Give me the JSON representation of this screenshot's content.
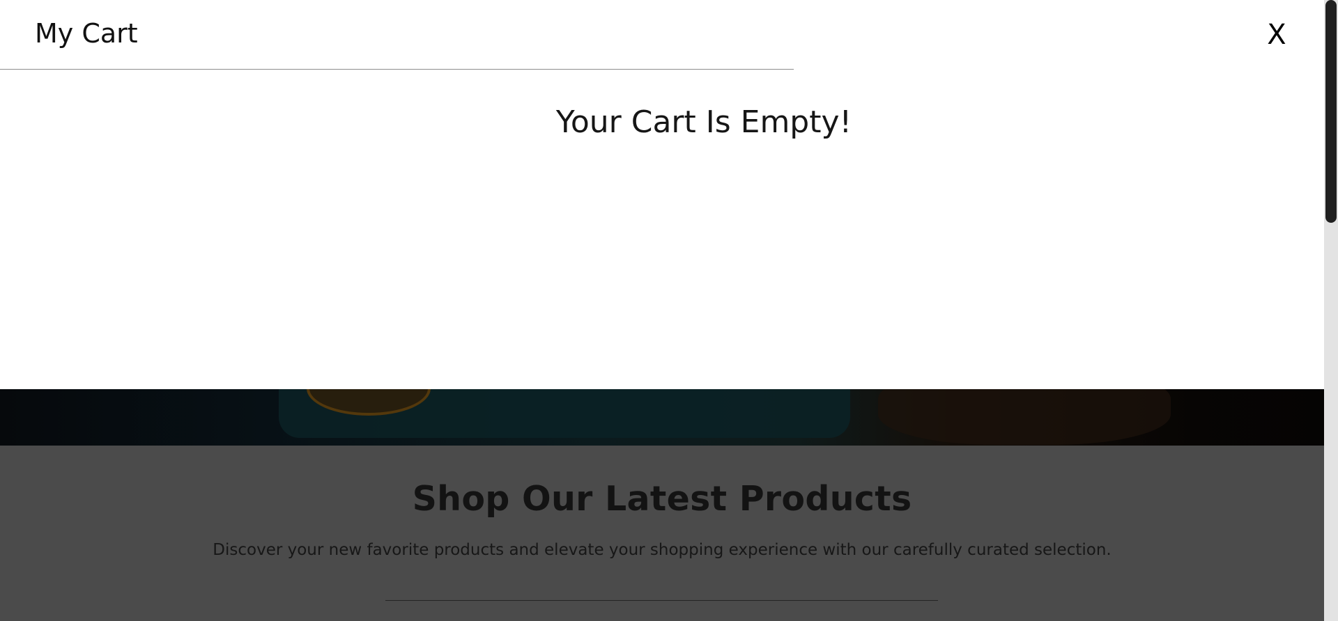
{
  "cart": {
    "title": "My Cart",
    "close_label": "X",
    "empty_message": "Your Cart Is Empty!"
  },
  "products_section": {
    "title": "Shop Our Latest Products",
    "subtitle": "Discover your new favorite products and elevate your shopping experience with our carefully curated selection."
  },
  "colors": {
    "overlay_dim": "#4b4b4b",
    "cart_background": "#ffffff",
    "scroll_thumb": "#202020"
  }
}
